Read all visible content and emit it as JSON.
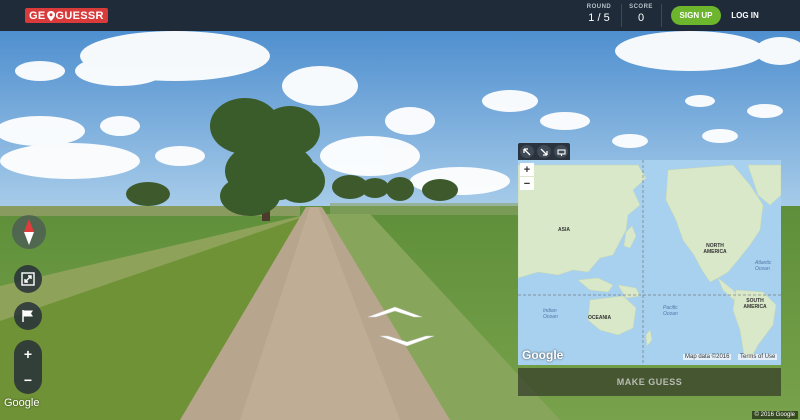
{
  "header": {
    "logo_left": "GE",
    "logo_right": "GUESSR",
    "round_label": "ROUND",
    "round_value": "1 / 5",
    "score_label": "SCORE",
    "score_value": "0",
    "signup_label": "SIGN UP",
    "login_label": "LOG IN"
  },
  "controls": {
    "zoom_in": "+",
    "zoom_out": "−",
    "google_logo": "Google",
    "copyright": "© 2016 Google"
  },
  "map": {
    "zoom_in": "+",
    "zoom_out": "−",
    "labels": {
      "asia": "ASIA",
      "north_america": "NORTH AMERICA",
      "south_america": "SOUTH AMERICA",
      "oceania": "OCEANIA",
      "atlantic": "Atlantic Ocean",
      "pacific": "Pacific Ocean",
      "indian": "Indian Ocean"
    },
    "google_logo": "Google",
    "map_data": "Map data ©2016",
    "terms": "Terms of Use",
    "make_guess": "MAKE GUESS"
  },
  "colors": {
    "header_bg": "#1f2b38",
    "logo_red": "#d93a3a",
    "signup_green": "#6cb52d",
    "ocean": "#a8d1ef",
    "land": "#d9e8c8"
  }
}
